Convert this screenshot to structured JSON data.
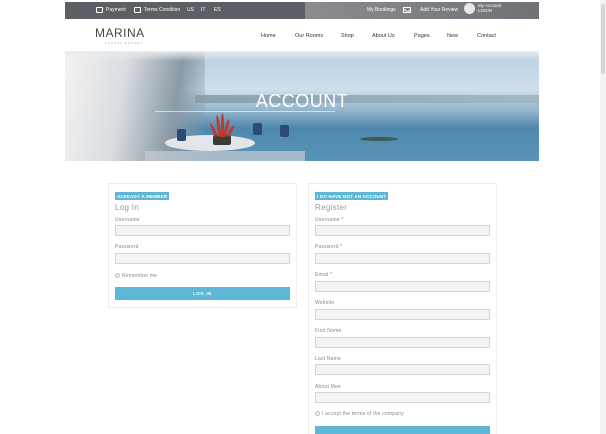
{
  "topbar": {
    "payment": "Payment",
    "terms": "Terms Condition",
    "lang_us": "US",
    "lang_it": "IT",
    "lang_es": "ES",
    "bookings": "My Bookings",
    "review": "Add Your Review",
    "account_line1": "My Account",
    "account_line2": "LOGIN"
  },
  "header": {
    "logo": "MARINA",
    "logo_sub": "LUXURY RESORT",
    "nav": [
      "Home",
      "Our Rooms",
      "Shop",
      "About Us",
      "Pages",
      "New",
      "Contact"
    ]
  },
  "hero": {
    "title": "ACCOUNT"
  },
  "login": {
    "badge": "ALREADY A MEMBER",
    "title": "Log In",
    "username_label": "Username",
    "password_label": "Password",
    "remember_label": "Remember me",
    "button": "LOG IN"
  },
  "register": {
    "badge": "I DO HAVE NOT AN ACCOUNT",
    "title": "Register",
    "username_label": "Username *",
    "password_label": "Password *",
    "email_label": "Email *",
    "website_label": "Website",
    "firstname_label": "First Name",
    "lastname_label": "Last Name",
    "about_label": "About Mee",
    "terms_label": "I accept the terms of the company"
  },
  "colors": {
    "accent": "#5cb8d6",
    "topbar": "#5d5f66"
  }
}
